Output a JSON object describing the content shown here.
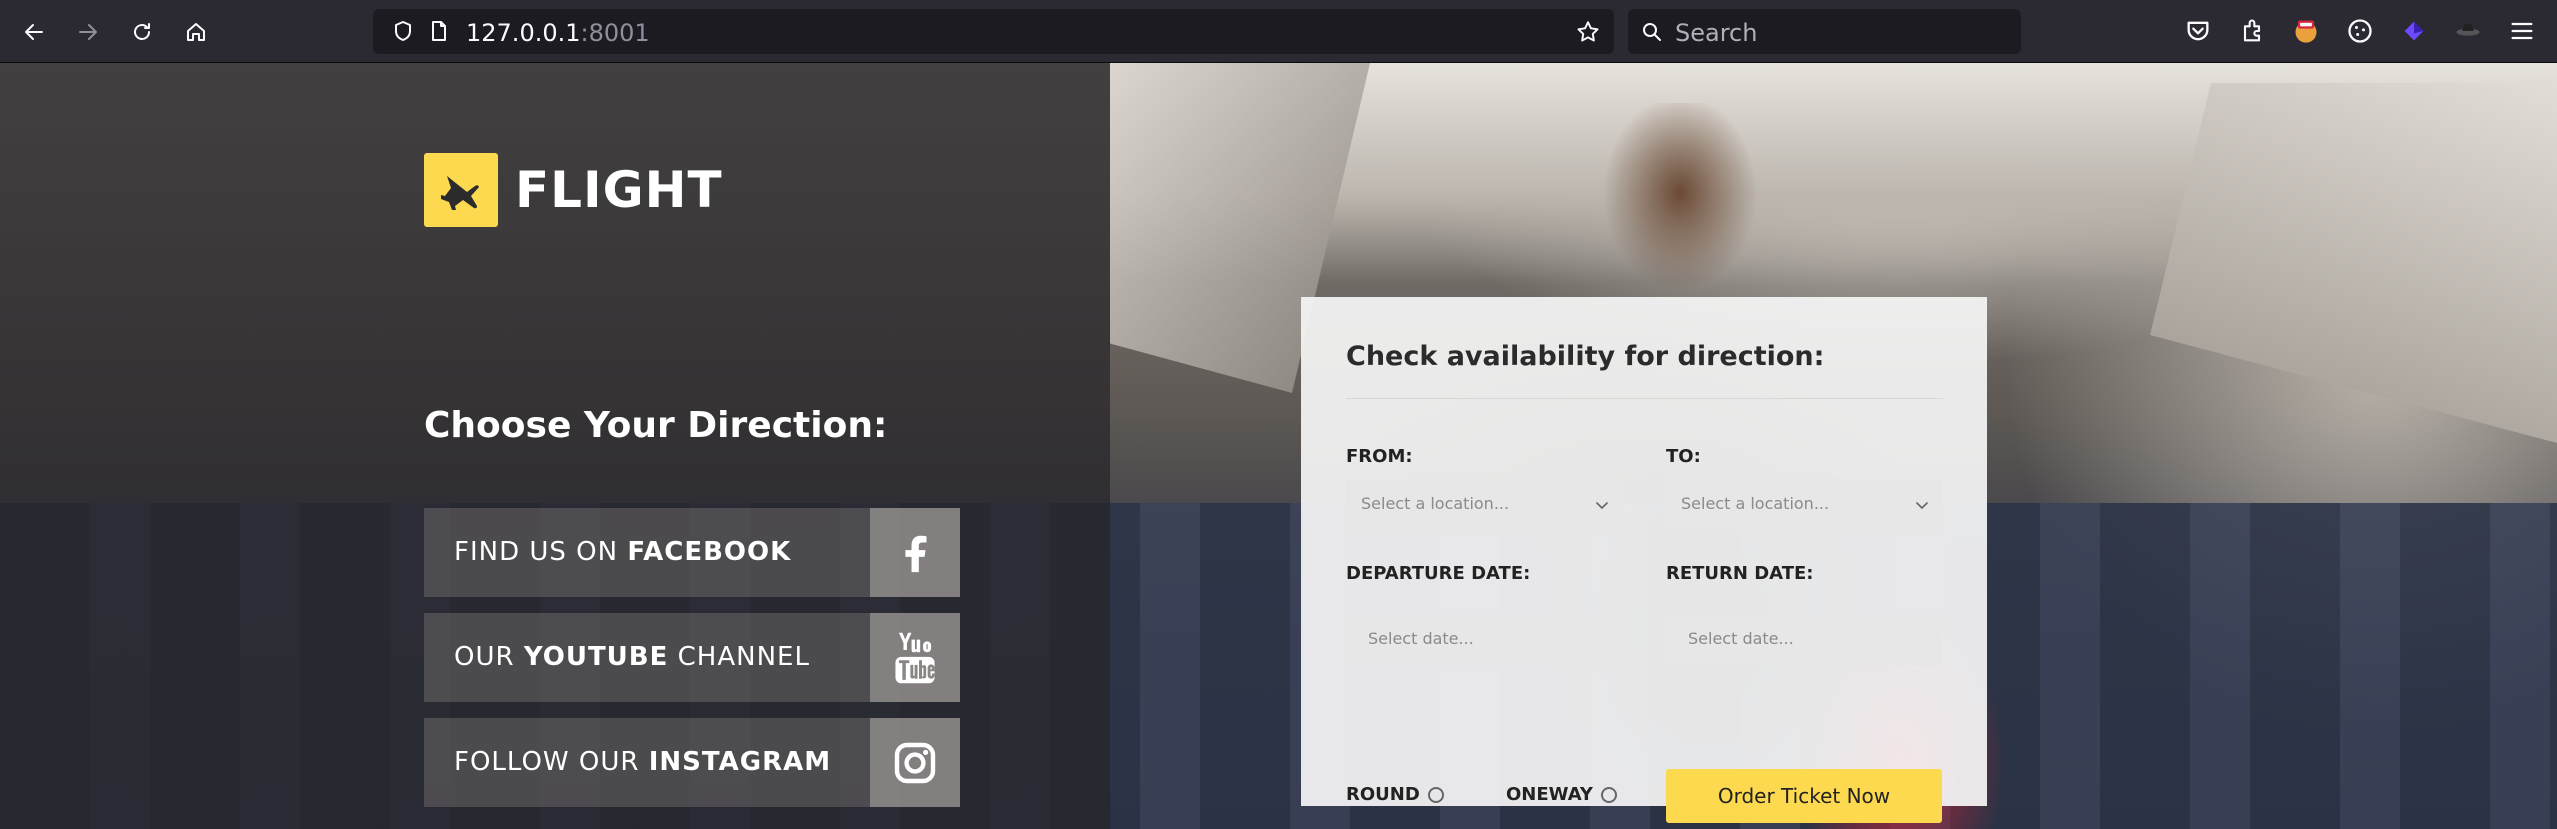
{
  "browser": {
    "url_host": "127.0.0.1",
    "url_port": ":8001",
    "search_placeholder": "Search",
    "icons": [
      "back-icon",
      "forward-icon",
      "reload-icon",
      "home-icon",
      "shield-icon",
      "page-icon",
      "star-icon",
      "search-icon",
      "pocket-icon",
      "extensions-icon",
      "ublock-icon",
      "cookie-icon",
      "proton-icon",
      "incognito-icon",
      "menu-icon"
    ]
  },
  "page": {
    "logo_text": "FLIGHT",
    "direction_heading": "Choose Your Direction:",
    "social": [
      {
        "prefix": "FIND US ON ",
        "bold": "FACEBOOK",
        "suffix": "",
        "icon": "facebook-icon"
      },
      {
        "prefix": "OUR ",
        "bold": "YOUTUBE",
        "suffix": " CHANNEL",
        "icon": "youtube-icon"
      },
      {
        "prefix": "FOLLOW OUR ",
        "bold": "INSTAGRAM",
        "suffix": "",
        "icon": "instagram-icon"
      }
    ],
    "booking": {
      "title": "Check availability for direction:",
      "from_label": "FROM:",
      "to_label": "TO:",
      "from_placeholder": "Select a location...",
      "to_placeholder": "Select a location...",
      "departure_label": "DEPARTURE DATE:",
      "return_label": "RETURN DATE:",
      "departure_placeholder": "Select date...",
      "return_placeholder": "Select date...",
      "round_label": "ROUND",
      "oneway_label": "ONEWAY",
      "order_button": "Order Ticket Now"
    },
    "colors": {
      "accent_yellow": "#fdd94f",
      "panel_bg": "#f5f5f5",
      "toolbar_bg": "#2b2a33"
    }
  }
}
